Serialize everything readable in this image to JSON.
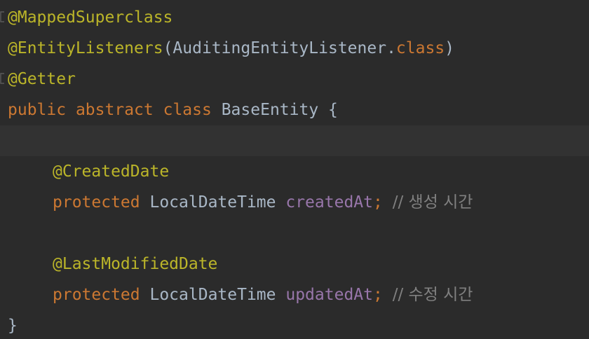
{
  "editor": {
    "lines": [
      {
        "annotation": "@MappedSuperclass"
      },
      {
        "annotation": "@EntityListeners",
        "paren_open": "(",
        "listener": "AuditingEntityListener",
        "dot": ".",
        "class_kw": "class",
        "paren_close": ")"
      },
      {
        "annotation": "@Getter"
      },
      {
        "kw_public": "public",
        "kw_abstract": "abstract",
        "kw_class": "class",
        "class_name": "BaseEntity",
        "brace_open": "{"
      },
      {},
      {
        "annotation": "@CreatedDate"
      },
      {
        "kw_protected": "protected",
        "type": "LocalDateTime",
        "field": "createdAt",
        "semicolon": ";",
        "comment": "// 생성 시간"
      },
      {},
      {
        "annotation": "@LastModifiedDate"
      },
      {
        "kw_protected": "protected",
        "type": "LocalDateTime",
        "field": "updatedAt",
        "semicolon": ";",
        "comment": "// 수정 시간"
      },
      {
        "brace_close": "}"
      }
    ]
  },
  "colors": {
    "background": "#2b2b2b",
    "current_line": "#323232",
    "annotation": "#bbb529",
    "keyword": "#cc7832",
    "identifier": "#a9b7c6",
    "field": "#9876aa",
    "comment": "#808080"
  },
  "icons": {
    "fold_markers": [
      "fold-marker-icon",
      "fold-marker-icon"
    ]
  }
}
